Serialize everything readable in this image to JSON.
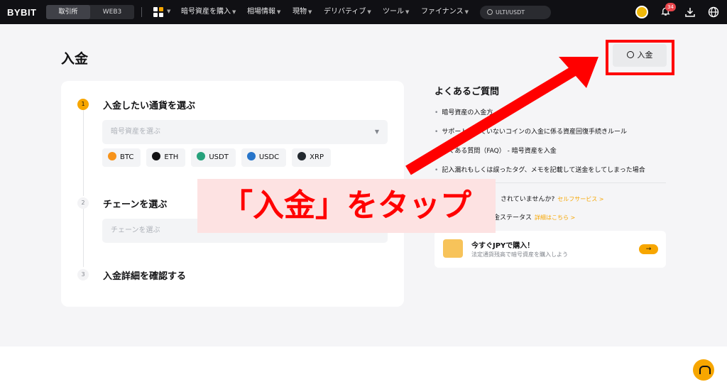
{
  "header": {
    "logo": "BYBIT",
    "segments": [
      "取引所",
      "WEB3"
    ],
    "nav": [
      "暗号資産を購入",
      "相場情報",
      "現物",
      "デリバティブ",
      "ツール",
      "ファイナンス"
    ],
    "search": "ULTI/USDT",
    "notification_count": "34"
  },
  "page": {
    "title": "入金",
    "deposit_button": "入金"
  },
  "steps": [
    {
      "num": "1",
      "title": "入金したい通貨を選ぶ",
      "placeholder": "暗号資産を選ぶ"
    },
    {
      "num": "2",
      "title": "チェーンを選ぶ",
      "placeholder": "チェーンを選ぶ"
    },
    {
      "num": "3",
      "title": "入金詳細を確認する"
    }
  ],
  "coins": [
    {
      "label": "BTC",
      "color": "#f7931a"
    },
    {
      "label": "ETH",
      "color": "#121214"
    },
    {
      "label": "USDT",
      "color": "#26a17b"
    },
    {
      "label": "USDC",
      "color": "#2775ca"
    },
    {
      "label": "XRP",
      "color": "#23292f"
    }
  ],
  "faq": {
    "title": "よくあるご質問",
    "items": [
      "暗号資産の入金方",
      "サポートされていないコインの入金に係る資産回復手続きルール",
      "よくある質問（FAQ） - 暗号資産を入金",
      "記入漏れもしくは誤ったタグ、メモを記載して送金をしてしまった場合"
    ],
    "help1_text": "されていませんか?",
    "help1_link": "セルフサービス >",
    "help2_text": "金ステータス",
    "help2_link": "詳細はこちら >"
  },
  "promo": {
    "title": "今すぐJPYで購入！",
    "subtitle": "法定通貨残高で暗号資産を購入しよう",
    "arrow": "→"
  },
  "annotation": {
    "callout": "「入金」をタップ",
    "color": "#ff0000"
  }
}
